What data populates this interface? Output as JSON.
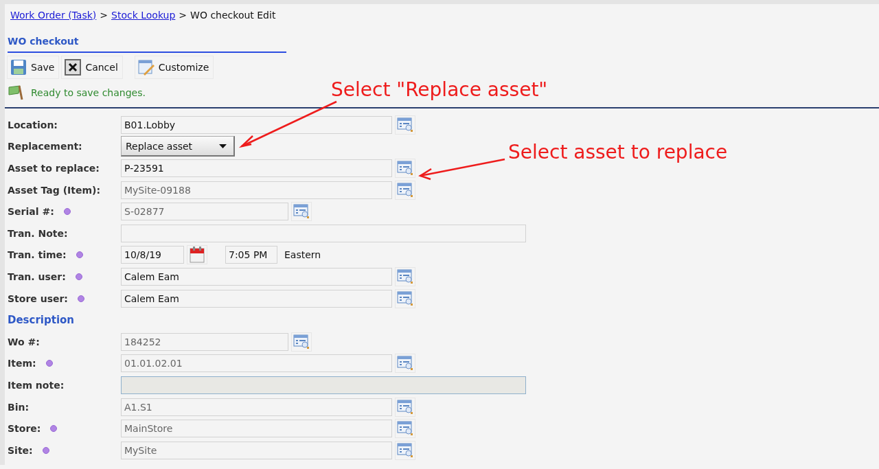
{
  "breadcrumb": [
    {
      "kind": "link",
      "label": "Work Order (Task)"
    },
    {
      "kind": "separator",
      "label": ">"
    },
    {
      "kind": "link",
      "label": "Stock Lookup"
    },
    {
      "kind": "separator",
      "label": ">"
    },
    {
      "kind": "current",
      "label": "WO checkout Edit"
    }
  ],
  "form_title": "WO checkout",
  "toolbar": [
    "Save",
    "Cancel",
    "Customize"
  ],
  "status": "Ready to save changes.",
  "rows": [
    {
      "kind": "lookup",
      "label": "Location:",
      "value": "B01.Lobby",
      "required": false,
      "readonly": false
    },
    {
      "kind": "select",
      "label": "Replacement:",
      "value": "Replace asset",
      "required": false
    },
    {
      "kind": "lookup",
      "label": "Asset to replace:",
      "value": "P-23591",
      "required": false,
      "readonly": false
    },
    {
      "kind": "lookup",
      "label": "Asset Tag (Item):",
      "value": "MySite-09188",
      "required": false,
      "readonly": true
    },
    {
      "kind": "shortlookup",
      "label": "Serial #:",
      "value": "S-02877",
      "required": true,
      "readonly": true
    },
    {
      "kind": "note",
      "label": "Tran. Note:",
      "required": false,
      "readonly": false
    },
    {
      "kind": "datetime",
      "label": "Tran. time:",
      "date": "10/8/19",
      "time": "7:05 PM",
      "zone": "Eastern",
      "required": true
    },
    {
      "kind": "lookup",
      "label": "Tran. user:",
      "value": "Calem Eam",
      "required": true,
      "readonly": false
    },
    {
      "kind": "lookup",
      "label": "Store user:",
      "value": "Calem Eam",
      "required": true,
      "readonly": false
    },
    {
      "kind": "heading",
      "label": "Description"
    },
    {
      "kind": "shortlookup",
      "label": "Wo #:",
      "value": "184252",
      "required": false,
      "readonly": true
    },
    {
      "kind": "lookup",
      "label": "Item:",
      "value": "01.01.02.01",
      "required": true,
      "readonly": true
    },
    {
      "kind": "note",
      "label": "Item note:",
      "required": false,
      "readonly": true
    },
    {
      "kind": "lookup",
      "label": "Bin:",
      "value": "A1.S1",
      "required": false,
      "readonly": true
    },
    {
      "kind": "lookup",
      "label": "Store:",
      "value": "MainStore",
      "required": true,
      "readonly": true
    },
    {
      "kind": "lookup",
      "label": "Site:",
      "value": "MySite",
      "required": true,
      "readonly": true
    }
  ],
  "annotations": [
    "Select \"Replace asset\"",
    "Select asset to replace"
  ]
}
